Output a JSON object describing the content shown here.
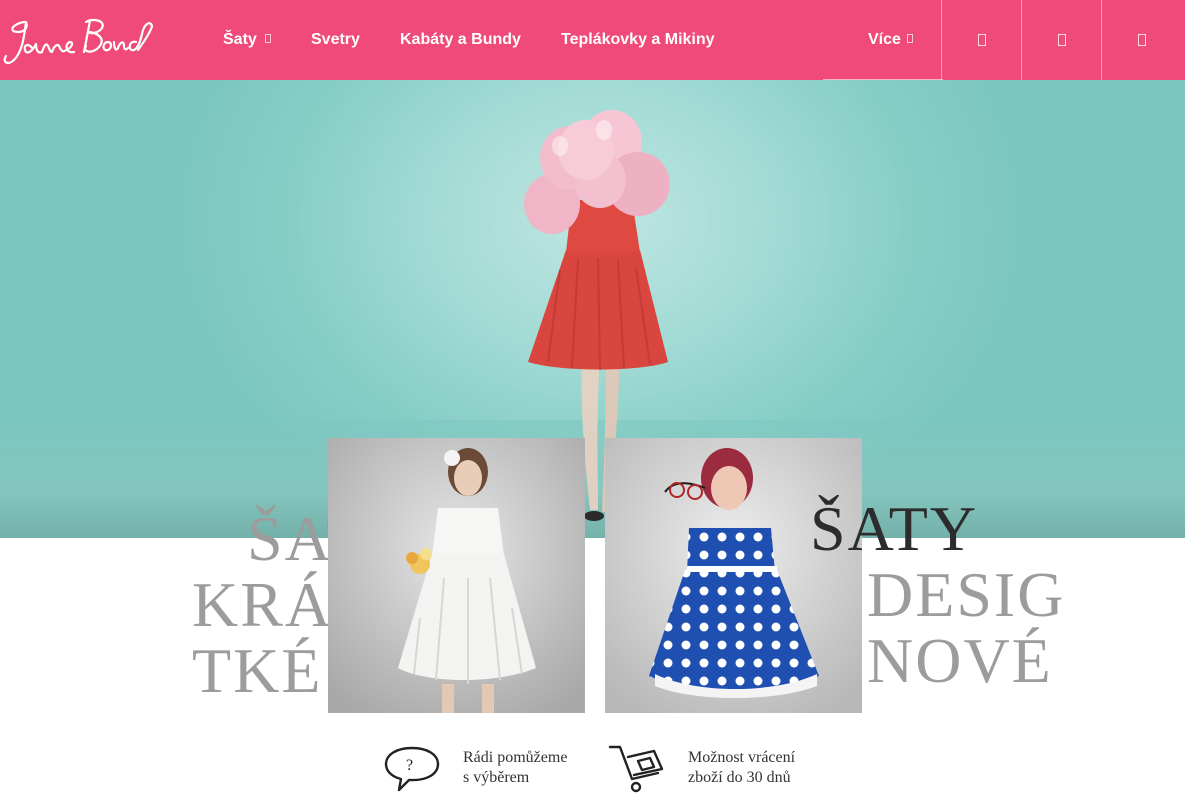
{
  "brand": {
    "logo_text": "Jane Bond",
    "accent": "#ef4a79"
  },
  "nav": {
    "items": [
      {
        "label": "Šaty",
        "has_dropdown": true
      },
      {
        "label": "Svetry",
        "has_dropdown": false
      },
      {
        "label": "Kabáty a Bundy",
        "has_dropdown": false
      },
      {
        "label": "Teplákovky a Mikiny",
        "has_dropdown": false
      }
    ],
    "more": {
      "label": "Více",
      "has_dropdown": true
    },
    "icons": [
      "search-icon",
      "user-icon",
      "cart-icon"
    ]
  },
  "categories": [
    {
      "lines": [
        "ŠATY",
        "KRÁ",
        "TKÉ"
      ]
    },
    {
      "lines": [
        "ŠATY",
        "DESIG",
        "NOVÉ"
      ]
    }
  ],
  "features": [
    {
      "icon": "question-bubble-icon",
      "text": "Rádi pomůžeme\ns výběrem"
    },
    {
      "icon": "cart-return-icon",
      "text": "Možnost vrácení\nzboží do 30 dnů"
    }
  ]
}
